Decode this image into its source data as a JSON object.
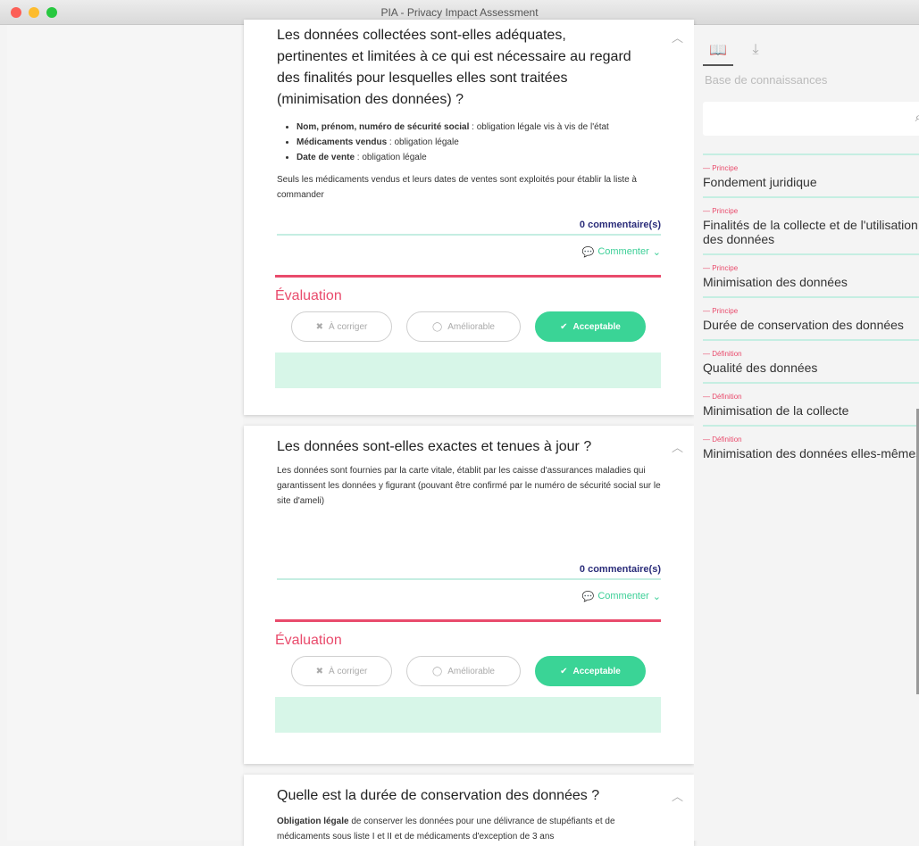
{
  "window": {
    "title": "PIA - Privacy Impact Assessment"
  },
  "cards": [
    {
      "question": "Les données collectées sont-elles adéquates, pertinentes et limitées à ce qui est nécessaire au regard des finalités pour lesquelles elles sont traitées (minimisation des données) ?",
      "bullets": [
        {
          "bold": "Nom, prénom, numéro de sécurité social",
          "rest": " : obligation légale vis à vis de l'état"
        },
        {
          "bold": "Médicaments vendus",
          "rest": " : obligation légale"
        },
        {
          "bold": "Date de vente",
          "rest": " : obligation légale"
        }
      ],
      "paragraph": "Seuls les médicaments vendus et leurs dates de ventes sont exploités pour établir la liste à commander",
      "comments_count": "0 commentaire(s)",
      "comment_button": "Commenter",
      "evaluation_title": "Évaluation",
      "btn_correct": "À corriger",
      "btn_improve": "Améliorable",
      "btn_ok": "Acceptable"
    },
    {
      "question": "Les données sont-elles exactes et tenues à jour ?",
      "paragraph": "Les données sont fournies par la carte vitale, établit par les caisse d'assurances maladies qui garantissent les données y figurant (pouvant être confirmé par le numéro de sécurité social sur le site d'ameli)",
      "comments_count": "0 commentaire(s)",
      "comment_button": "Commenter",
      "evaluation_title": "Évaluation",
      "btn_correct": "À corriger",
      "btn_improve": "Améliorable",
      "btn_ok": "Acceptable"
    },
    {
      "question": "Quelle est la durée de conservation des données ?",
      "bold_lead": "Obligation légale",
      "paragraph": " de conserver les données pour une délivrance de stupéfiants et de médicaments sous liste I et II et de médicaments d'exception de 3 ans"
    }
  ],
  "sidebar": {
    "title": "Base de connaissances",
    "search_placeholder": "",
    "items": [
      {
        "category": "Principe",
        "name": "Fondement juridique"
      },
      {
        "category": "Principe",
        "name": "Finalités de la collecte et de l'utilisation des données"
      },
      {
        "category": "Principe",
        "name": "Minimisation des données"
      },
      {
        "category": "Principe",
        "name": "Durée de conservation des données"
      },
      {
        "category": "Définition",
        "name": "Qualité des données"
      },
      {
        "category": "Définition",
        "name": "Minimisation de la collecte"
      },
      {
        "category": "Définition",
        "name": "Minimisation des données elles-mêmes"
      }
    ]
  },
  "colors": {
    "accent_green": "#3ad496",
    "accent_red": "#e94b6c",
    "link_blue": "#2b2d7a"
  },
  "icons": [
    "book-icon",
    "download-icon",
    "search-icon",
    "comment-icon",
    "chevron-up-icon",
    "cross-icon",
    "refresh-icon",
    "check-icon"
  ]
}
